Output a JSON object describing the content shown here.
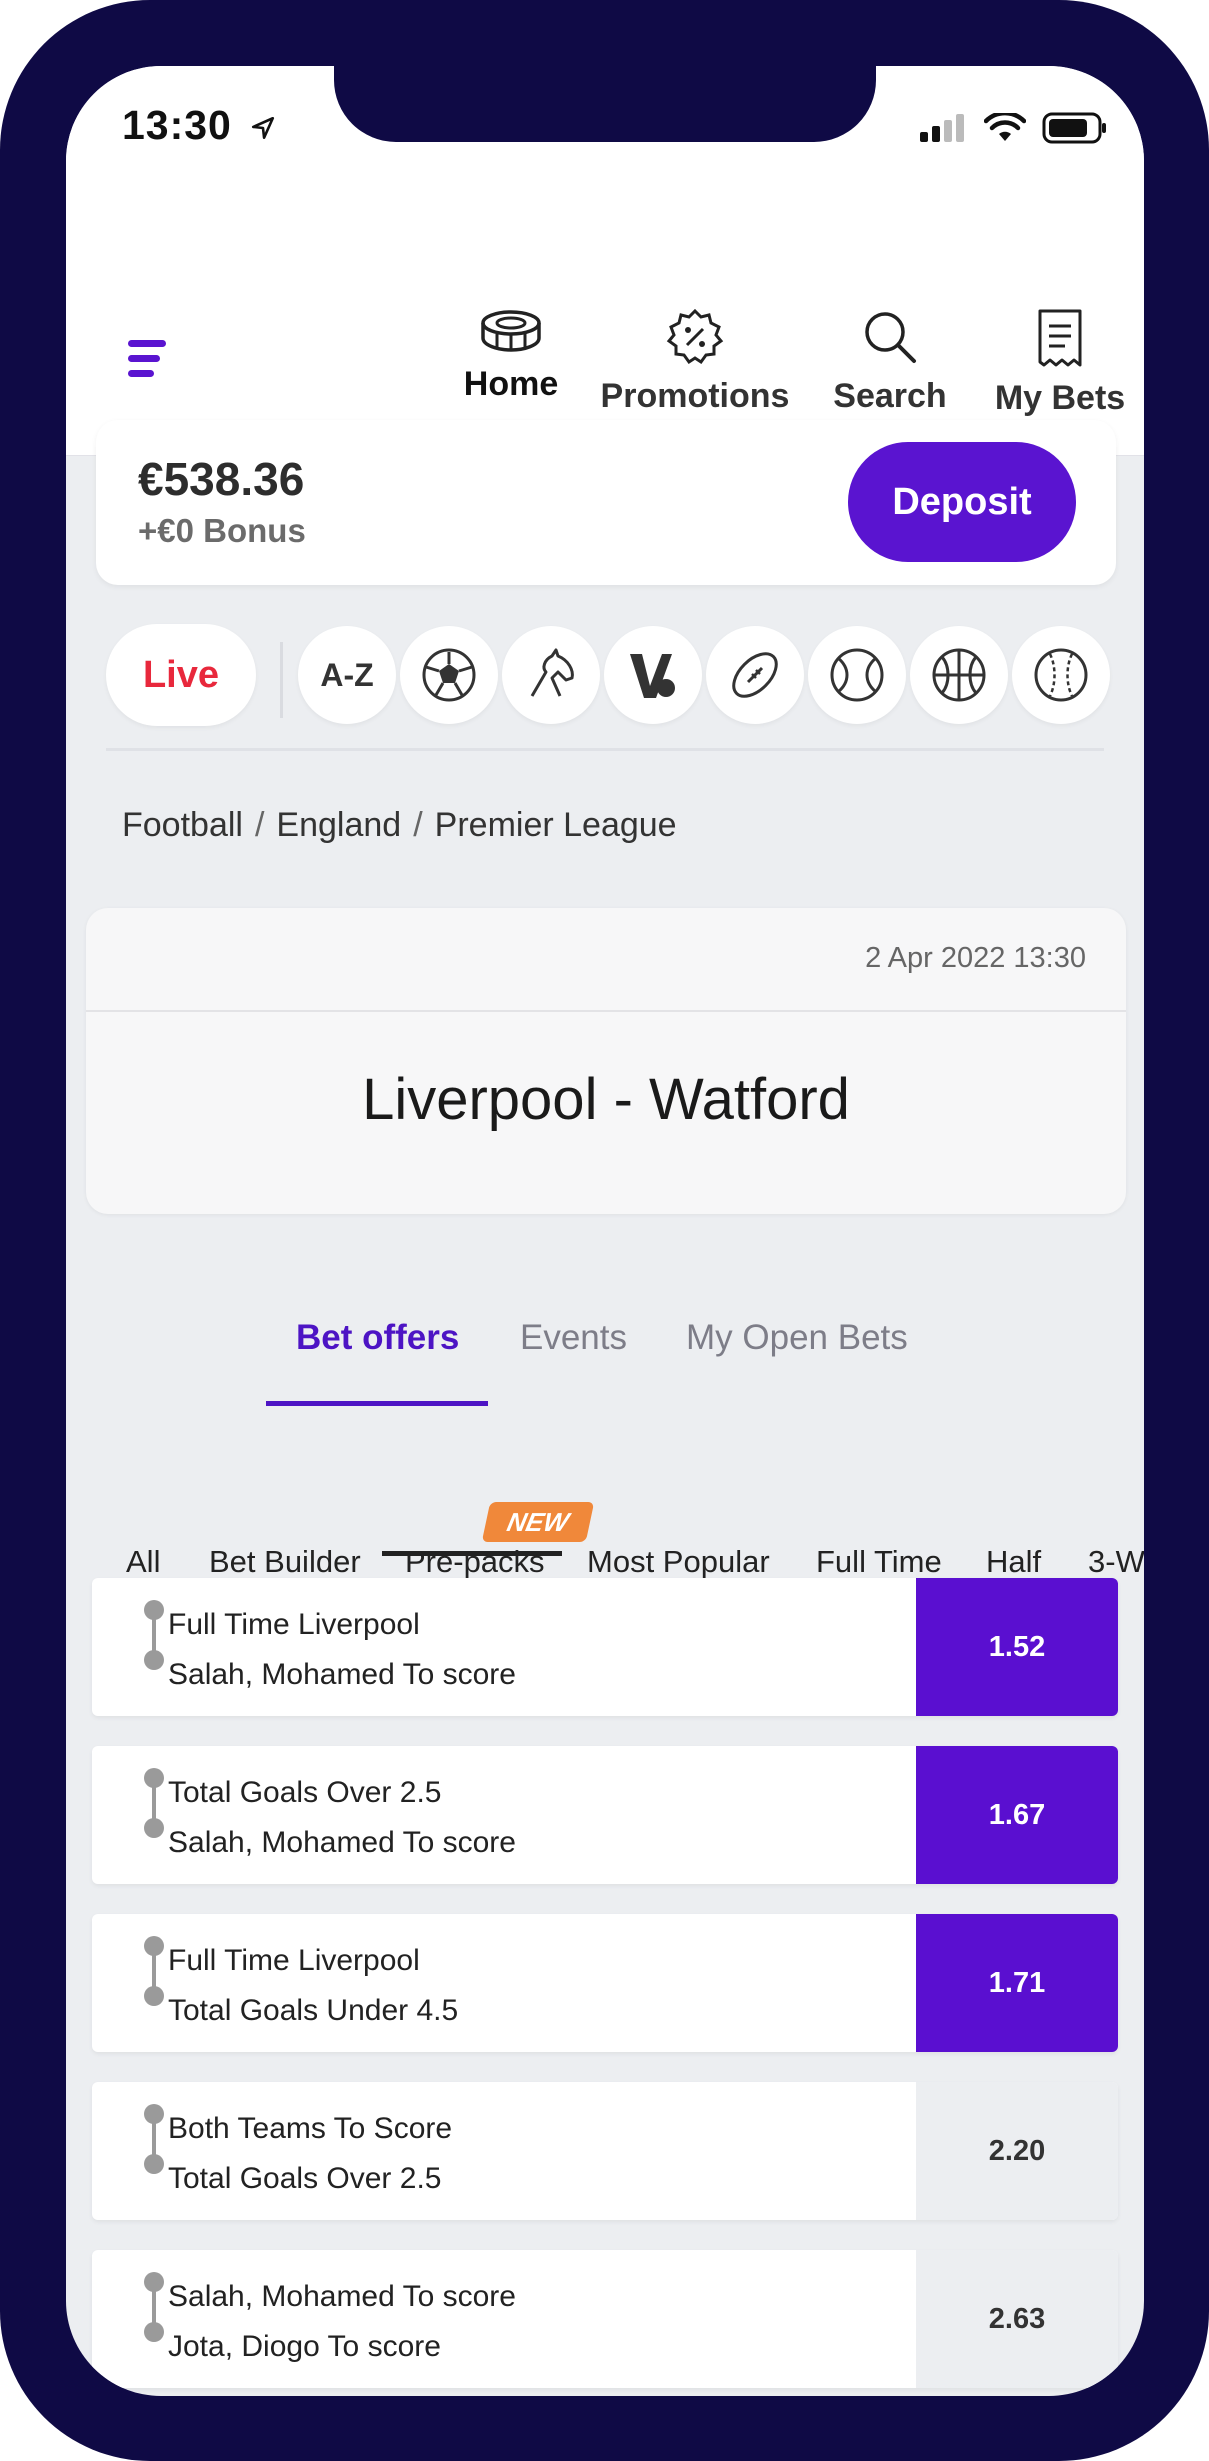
{
  "status_bar": {
    "time": "13:30"
  },
  "nav": {
    "items": [
      {
        "label": "Home",
        "icon": "stadium-icon"
      },
      {
        "label": "Promotions",
        "icon": "percent-badge-icon"
      },
      {
        "label": "Search",
        "icon": "search-icon"
      },
      {
        "label": "My Bets",
        "icon": "receipt-icon"
      }
    ],
    "active": "Home"
  },
  "account": {
    "balance": "€538.36",
    "bonus": "+€0 Bonus",
    "deposit_label": "Deposit"
  },
  "sports_bar": {
    "live_label": "Live",
    "az_label": "A-Z",
    "icons": [
      "football-icon",
      "horse-racing-icon",
      "v-sports-icon",
      "american-football-icon",
      "tennis-icon",
      "basketball-icon",
      "baseball-icon"
    ]
  },
  "breadcrumb": [
    "Football",
    "England",
    "Premier League"
  ],
  "event": {
    "date": "2 Apr 2022 13:30",
    "title": "Liverpool - Watford"
  },
  "tabs": [
    "Bet offers",
    "Events",
    "My Open Bets"
  ],
  "active_tab": "Bet offers",
  "filters": [
    "All",
    "Bet Builder",
    "Pre-packs",
    "Most Popular",
    "Full Time",
    "Half",
    "3-W"
  ],
  "active_filter": "Pre-packs",
  "new_badge": "NEW",
  "bets": [
    {
      "line1": "Full Time Liverpool",
      "line2": "Salah, Mohamed To score",
      "odds": "1.52",
      "selected": true
    },
    {
      "line1": "Total Goals Over 2.5",
      "line2": "Salah, Mohamed To score",
      "odds": "1.67",
      "selected": true
    },
    {
      "line1": "Full Time Liverpool",
      "line2": "Total Goals Under 4.5",
      "odds": "1.71",
      "selected": true
    },
    {
      "line1": "Both Teams To Score",
      "line2": "Total Goals Over 2.5",
      "odds": "2.20",
      "selected": false
    },
    {
      "line1": "Salah, Mohamed To score",
      "line2": "Jota, Diogo To score",
      "odds": "2.63",
      "selected": false
    }
  ],
  "colors": {
    "brand": "#5a14d0",
    "live": "#e8283c",
    "new_badge": "#f0883a",
    "frame": "#0f0a45"
  }
}
